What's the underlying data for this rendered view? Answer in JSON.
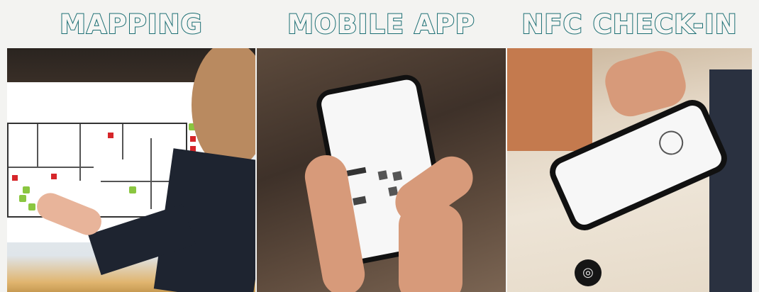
{
  "panels": [
    {
      "title": "MAPPING"
    },
    {
      "title": "MOBILE APP"
    },
    {
      "title": "NFC CHECK-IN"
    }
  ],
  "colors": {
    "title_outline": "#1b6e73",
    "background": "#f3f3f1"
  }
}
